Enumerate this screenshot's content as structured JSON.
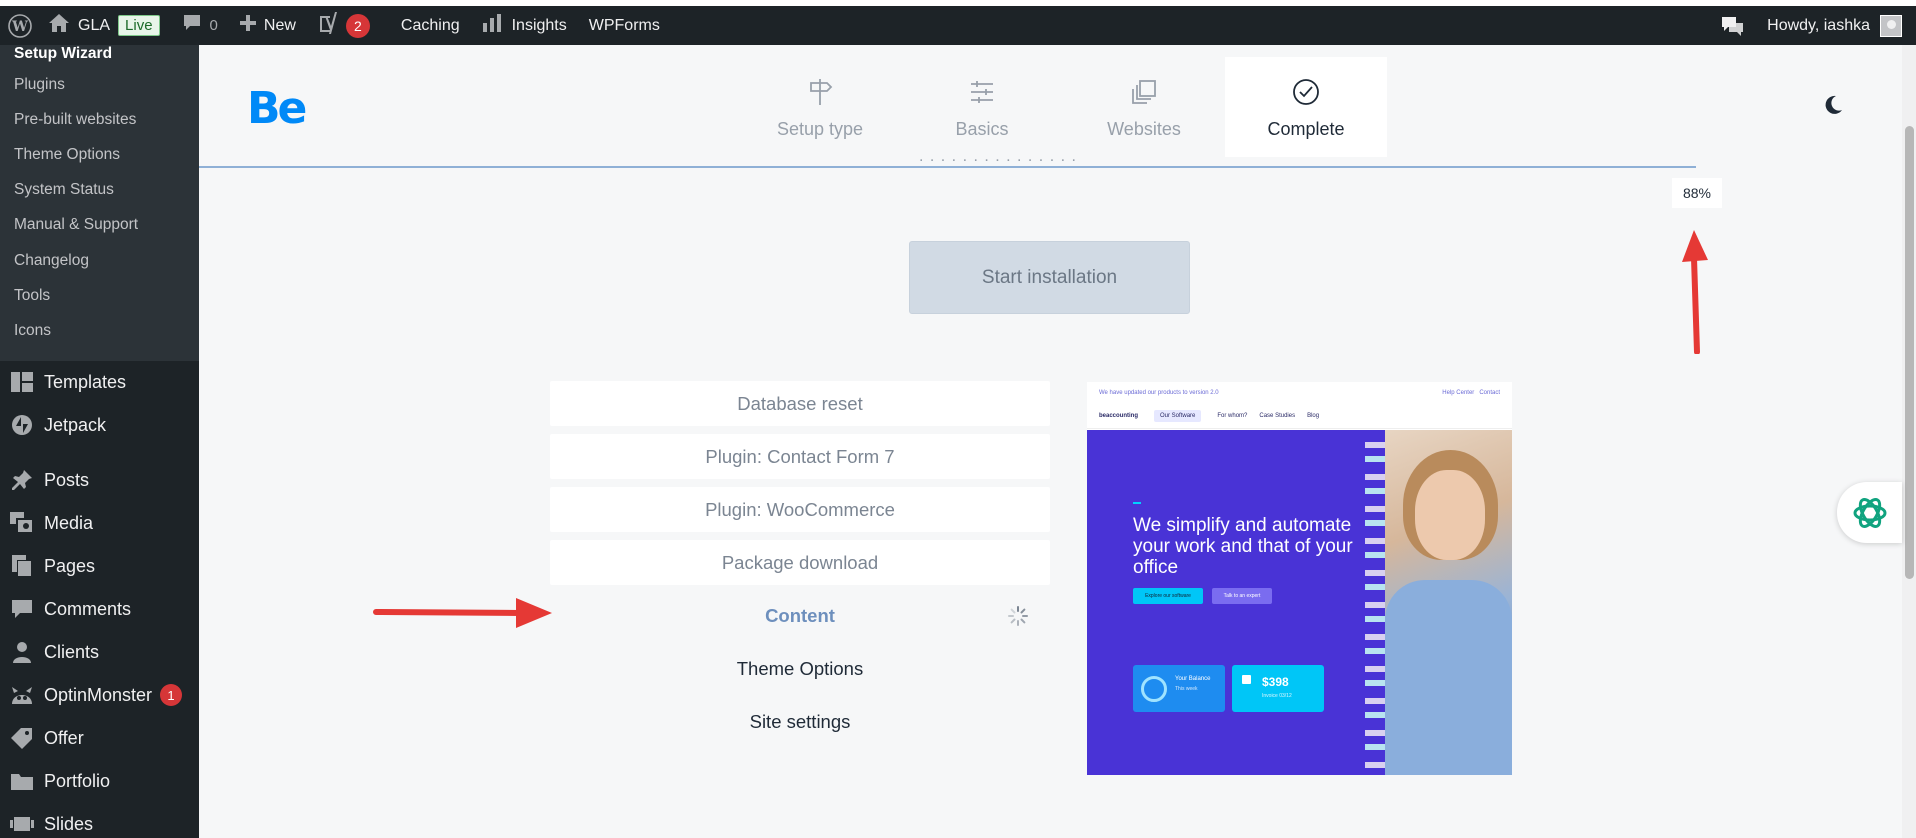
{
  "admin_bar": {
    "site_name": "GLA",
    "live_label": "Live",
    "comments_count": "0",
    "new_label": "New",
    "yoast_count": "2",
    "caching_label": "Caching",
    "insights_label": "Insights",
    "wpforms_label": "WPForms",
    "howdy_label": "Howdy, iashka"
  },
  "sidebar": {
    "submenu": [
      "Setup Wizard",
      "Plugins",
      "Pre-built websites",
      "Theme Options",
      "System Status",
      "Manual & Support",
      "Changelog",
      "Tools",
      "Icons"
    ],
    "menu": [
      {
        "label": "Templates",
        "icon": "templates-icon"
      },
      {
        "label": "Jetpack",
        "icon": "jetpack-icon"
      },
      {
        "label": "Posts",
        "icon": "pin-icon"
      },
      {
        "label": "Media",
        "icon": "media-icon"
      },
      {
        "label": "Pages",
        "icon": "pages-icon"
      },
      {
        "label": "Comments",
        "icon": "comment-icon"
      },
      {
        "label": "Clients",
        "icon": "user-icon"
      },
      {
        "label": "OptinMonster",
        "icon": "optinmonster-icon",
        "badge": "1"
      },
      {
        "label": "Offer",
        "icon": "tag-icon"
      },
      {
        "label": "Portfolio",
        "icon": "folder-icon"
      },
      {
        "label": "Slides",
        "icon": "slides-icon"
      }
    ]
  },
  "wizard": {
    "logo": "Be",
    "steps": [
      {
        "label": "Setup type",
        "icon": "signpost-icon",
        "active": false
      },
      {
        "label": "Basics",
        "icon": "sliders-icon",
        "active": false
      },
      {
        "label": "Websites",
        "icon": "layers-icon",
        "active": false
      },
      {
        "label": "Complete",
        "icon": "check-circle-icon",
        "active": true
      }
    ],
    "progress_percent": "88%",
    "progress_fraction": 0.88,
    "start_button": "Start installation",
    "tasks": [
      {
        "label": "Database reset",
        "state": "done"
      },
      {
        "label": "Plugin: Contact Form 7",
        "state": "done"
      },
      {
        "label": "Plugin: WooCommerce",
        "state": "done"
      },
      {
        "label": "Package download",
        "state": "done"
      },
      {
        "label": "Content",
        "state": "running"
      },
      {
        "label": "Theme Options",
        "state": "pending"
      },
      {
        "label": "Site settings",
        "state": "pending"
      }
    ]
  },
  "preview": {
    "top_notice": "We have updated our products to version 2.0",
    "top_links": [
      "Help Center",
      "Contact"
    ],
    "brand": "beaccounting",
    "nav_pill": "Our Software",
    "nav_items": [
      "For whom?",
      "Case Studies",
      "Blog"
    ],
    "headline": "We simplify and automate your work and that of your office",
    "btn_primary": "Explore our software",
    "btn_secondary": "Talk to an expert",
    "card1_title": "Your Balance",
    "card1_sub": "This week",
    "card2_value": "$398",
    "card2_sub": "Invoice 03/12"
  },
  "colors": {
    "admin_bg": "#1d2327",
    "accent_blue": "#0089f7",
    "annotation_red": "#e53935"
  }
}
